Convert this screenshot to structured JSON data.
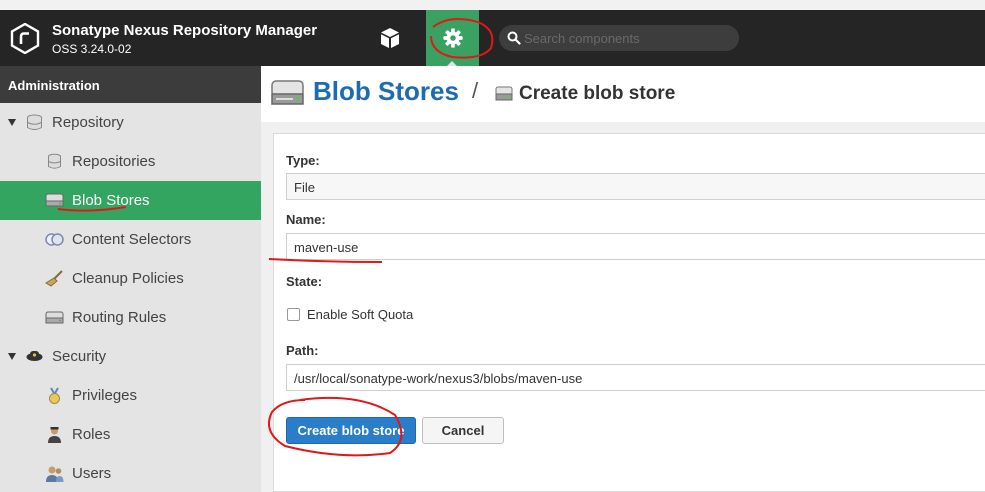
{
  "header": {
    "app_title": "Sonatype Nexus Repository Manager",
    "app_version": "OSS 3.24.0-02",
    "search_placeholder": "Search components",
    "brand_color": "#3aa163"
  },
  "sidebar": {
    "section_title": "Administration",
    "items": [
      {
        "label": "Repository",
        "icon": "database-icon",
        "type": "group"
      },
      {
        "label": "Repositories",
        "icon": "database-icon",
        "type": "child"
      },
      {
        "label": "Blob Stores",
        "icon": "drive-icon",
        "type": "child",
        "active": true
      },
      {
        "label": "Content Selectors",
        "icon": "selector-icon",
        "type": "child"
      },
      {
        "label": "Cleanup Policies",
        "icon": "broom-icon",
        "type": "child"
      },
      {
        "label": "Routing Rules",
        "icon": "drive-icon",
        "type": "child"
      },
      {
        "label": "Security",
        "icon": "police-badge-icon",
        "type": "group"
      },
      {
        "label": "Privileges",
        "icon": "medal-icon",
        "type": "child"
      },
      {
        "label": "Roles",
        "icon": "user-role-icon",
        "type": "child"
      },
      {
        "label": "Users",
        "icon": "users-icon",
        "type": "child"
      }
    ]
  },
  "breadcrumb": {
    "title": "Blob Stores",
    "separator": "/",
    "current": "Create blob store"
  },
  "form": {
    "type_label": "Type:",
    "type_value": "File",
    "name_label": "Name:",
    "name_value": "maven-use",
    "state_label": "State:",
    "soft_quota_label": "Enable Soft Quota",
    "path_label": "Path:",
    "path_value": "/usr/local/sonatype-work/nexus3/blobs/maven-use",
    "submit_label": "Create blob store",
    "cancel_label": "Cancel"
  }
}
